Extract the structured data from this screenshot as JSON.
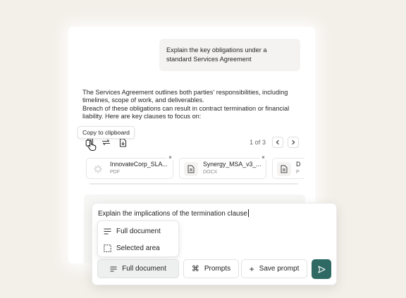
{
  "conversation": {
    "user_message": "Explain the key obligations under a standard Services Agreement",
    "assistant_lines": [
      "The Services Agreement outlines both parties' responsibilities, including",
      "timelines, scope of work, and deliverables.",
      "Breach of these obligations can result in contract termination or financial",
      "liability. Here are key clauses to focus on:"
    ]
  },
  "message_actions": {
    "tooltip": "Copy to clipboard",
    "icons": [
      "copy-icon",
      "regenerate-icon",
      "export-icon"
    ]
  },
  "pager": {
    "label": "1 of 3"
  },
  "attachments": [
    {
      "name": "InnovateCorp_SLA...",
      "type": "PDF",
      "loading": true
    },
    {
      "name": "Synergy_MSA_v3_...",
      "type": "DOCX",
      "loading": false
    },
    {
      "name": "D",
      "type": "P",
      "loading": false
    }
  ],
  "composer": {
    "text": "Explain the implications of the termination clause",
    "scope_menu": [
      "Full document",
      "Selected area"
    ],
    "scope_button": "Full document",
    "prompts_button": "Prompts",
    "save_prompt_button": "Save prompt",
    "send_color": "#2e6a63"
  }
}
